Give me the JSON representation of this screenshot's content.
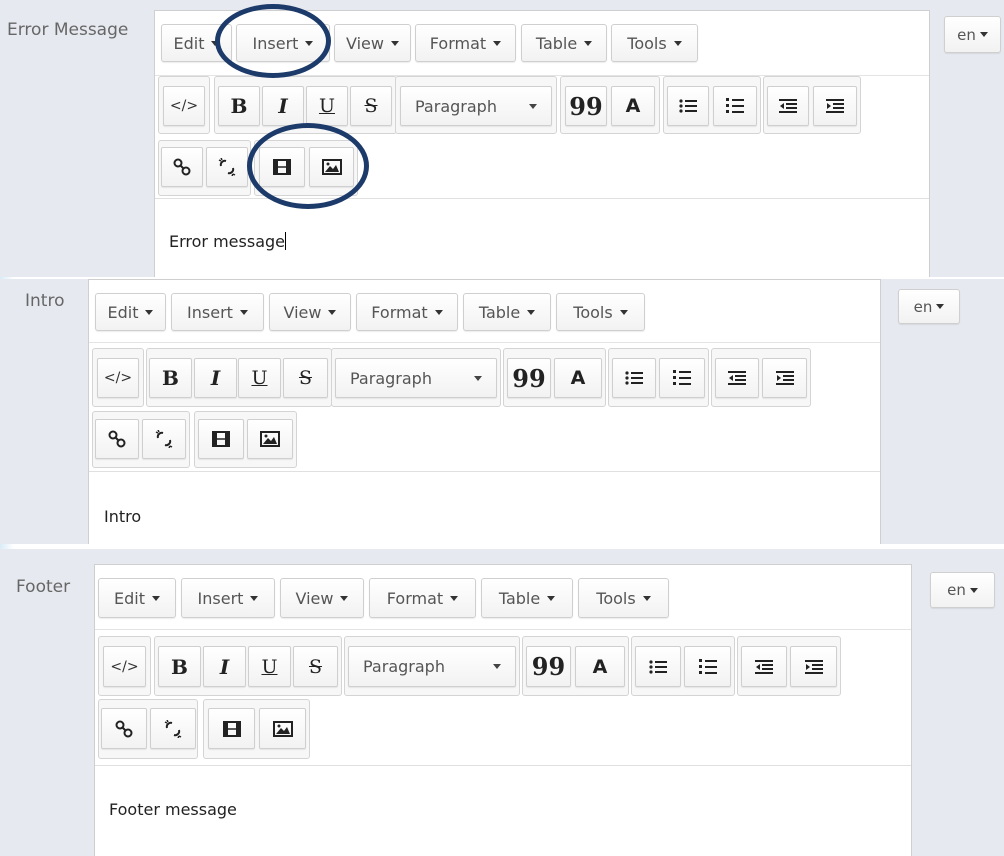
{
  "menu": {
    "edit": "Edit",
    "insert": "Insert",
    "view": "View",
    "format": "Format",
    "table": "Table",
    "tools": "Tools"
  },
  "toolbar": {
    "code": "</>",
    "bold": "B",
    "italic": "I",
    "underline": "U",
    "strike": "S",
    "block_format": "Paragraph",
    "blockquote": "99",
    "text_color": "A"
  },
  "icons": {
    "link": "link-icon",
    "unlink": "unlink-icon",
    "media": "film-icon",
    "image": "image-icon",
    "bullet_list": "bullet-list-icon",
    "numbered_list": "numbered-list-icon",
    "outdent": "outdent-icon",
    "indent": "indent-icon"
  },
  "colors": {
    "section_bg": "#e6eaf0",
    "highlight_ring": "#1c3a6a"
  },
  "sections": [
    {
      "label": "Error Message",
      "content": "Error message",
      "lang": "en"
    },
    {
      "label": "Intro",
      "content": "Intro",
      "lang": "en"
    },
    {
      "label": "Footer",
      "content": "Footer message",
      "lang": "en"
    }
  ]
}
